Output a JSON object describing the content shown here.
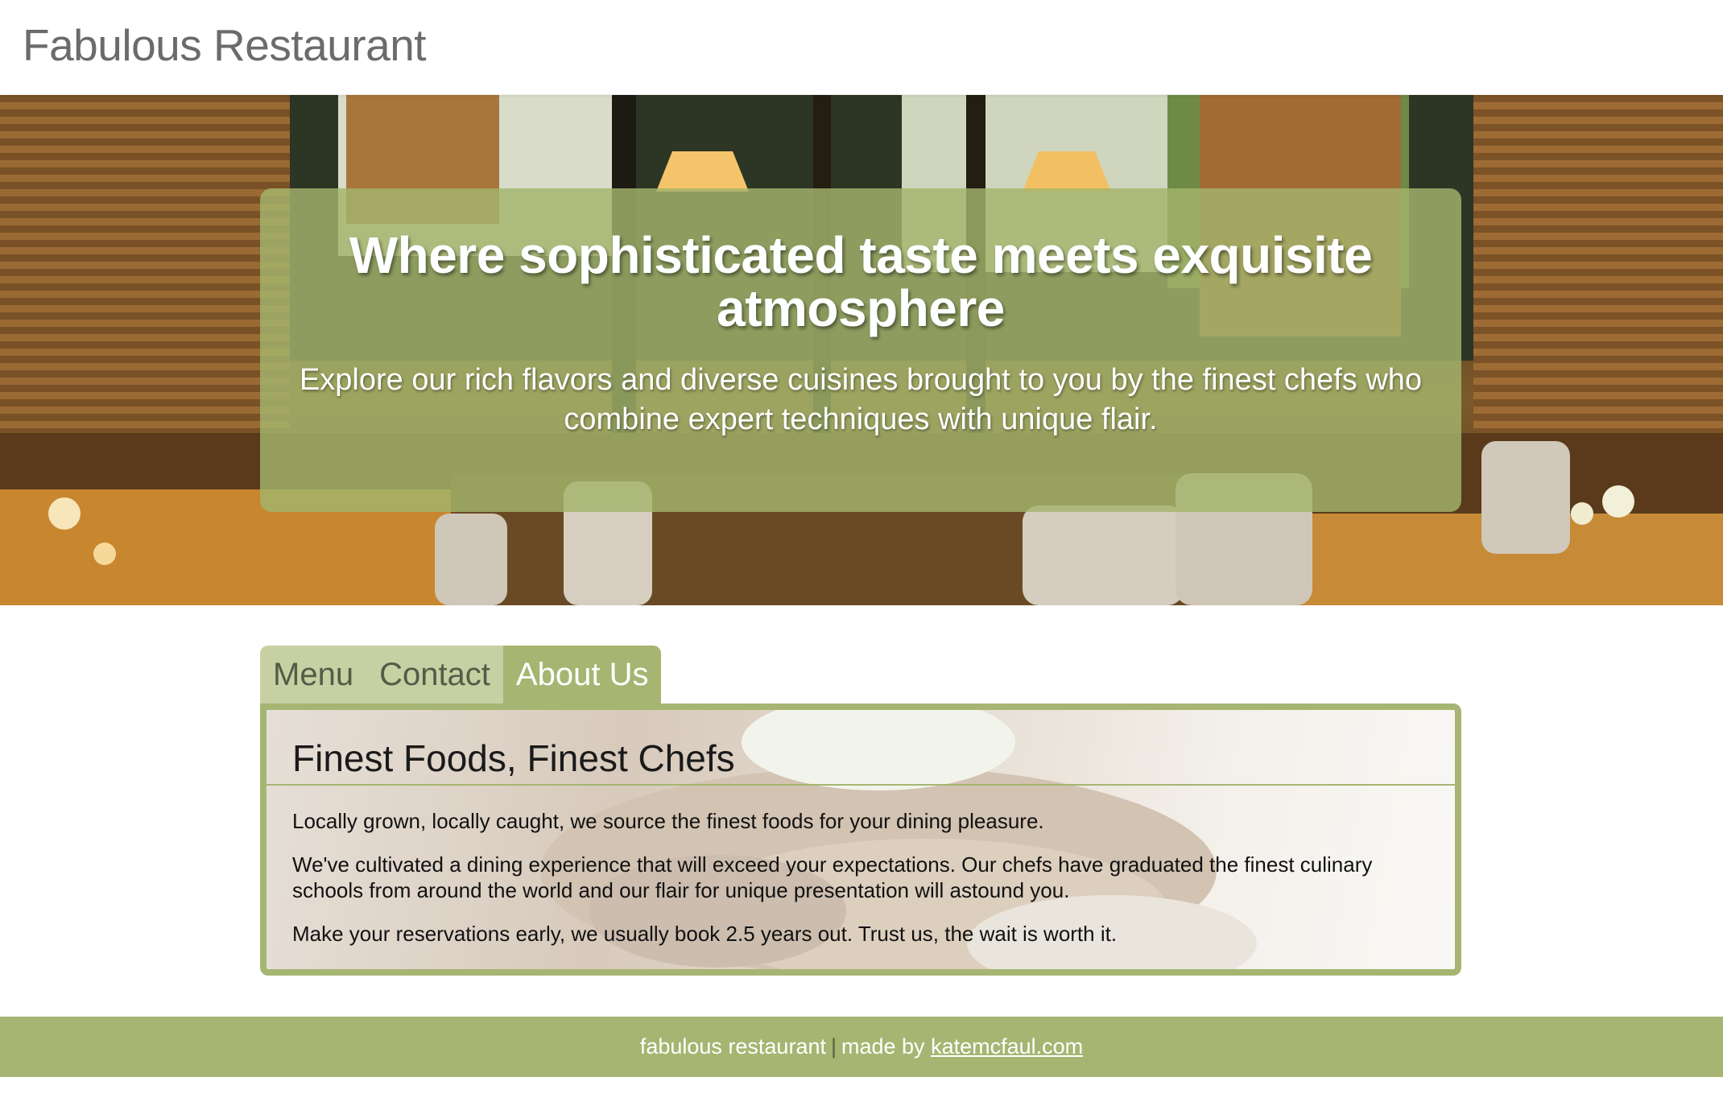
{
  "header": {
    "site_title": "Fabulous Restaurant"
  },
  "hero": {
    "heading": "Where sophisticated taste meets exquisite atmosphere",
    "subheading": "Explore our rich flavors and diverse cuisines brought to you by the finest chefs who combine expert techniques with unique flair."
  },
  "tabs": {
    "items": [
      {
        "label": "Menu"
      },
      {
        "label": "Contact"
      },
      {
        "label": "About Us"
      }
    ],
    "active": "About Us"
  },
  "content": {
    "heading": "Finest Foods, Finest Chefs",
    "paragraphs": [
      "Locally grown, locally caught, we source the finest foods for your dining pleasure.",
      "We've cultivated a dining experience that will exceed your expectations. Our chefs have graduated the finest culinary schools from around the world and our flair for unique presentation will astound you.",
      "Make your reservations early, we usually book 2.5 years out. Trust us, the wait is worth it."
    ]
  },
  "footer": {
    "text": "fabulous restaurant",
    "separator": "|",
    "made_by": "made by",
    "link": "katemcfaul.com"
  },
  "colors": {
    "accent": "#a6b571",
    "tab_inactive": "#c7d0a3",
    "hero_panel": "#a3b46c"
  }
}
